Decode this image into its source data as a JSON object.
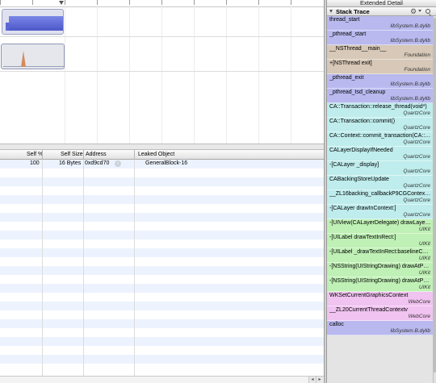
{
  "extended_detail_title": "Extended Detail",
  "stack_trace": {
    "title": "Stack Trace",
    "icons": [
      "triangle-disclosure-icon",
      "gear-icon",
      "search-icon"
    ],
    "frames": [
      {
        "function": "thread_start",
        "library": "libSystem.B.dylib",
        "color": "#b9b9ef"
      },
      {
        "function": "_pthread_start",
        "library": "libSystem.B.dylib",
        "color": "#b9b9ef"
      },
      {
        "function": "__NSThread__main__",
        "library": "Foundation",
        "color": "#d7c8b7"
      },
      {
        "function": "+[NSThread exit]",
        "library": "Foundation",
        "color": "#d7c8b7"
      },
      {
        "function": "_pthread_exit",
        "library": "libSystem.B.dylib",
        "color": "#b9b9ef"
      },
      {
        "function": "_pthread_tsd_cleanup",
        "library": "libSystem.B.dylib",
        "color": "#b9b9ef"
      },
      {
        "function": "CA::Transaction::release_thread(void*)",
        "library": "QuartzCore",
        "color": "#bfecec"
      },
      {
        "function": "CA::Transaction::commit()",
        "library": "QuartzCore",
        "color": "#bfecec"
      },
      {
        "function": "CA::Context::commit_transaction(CA::Tr...",
        "library": "QuartzCore",
        "color": "#bfecec"
      },
      {
        "function": "CALayerDisplayIfNeeded",
        "library": "QuartzCore",
        "color": "#bfecec"
      },
      {
        "function": "-[CALayer _display]",
        "library": "QuartzCore",
        "color": "#bfecec"
      },
      {
        "function": "CABackingStoreUpdate",
        "library": "QuartzCore",
        "color": "#bfecec"
      },
      {
        "function": "__ZL16backing_callbackP9CGContextPv",
        "library": "QuartzCore",
        "color": "#bfecec"
      },
      {
        "function": "-[CALayer drawInContext:]",
        "library": "QuartzCore",
        "color": "#bfecec"
      },
      {
        "function": "-[UIView(CALayerDelegate) drawLayer:in...",
        "library": "UIKit",
        "color": "#bff0b5"
      },
      {
        "function": "-[UILabel drawTextInRect:]",
        "library": "UIKit",
        "color": "#bff0b5"
      },
      {
        "function": "-[UILabel _drawTextInRect:baselineCalcu...",
        "library": "UIKit",
        "color": "#bff0b5"
      },
      {
        "function": "-[NSString(UIStringDrawing) drawAtPoint...",
        "library": "UIKit",
        "color": "#bff0b5"
      },
      {
        "function": "-[NSString(UIStringDrawing) drawAtPoint...",
        "library": "UIKit",
        "color": "#bff0b5"
      },
      {
        "function": "WKSetCurrentGraphicsContext",
        "library": "WebCore",
        "color": "#f0c3f0"
      },
      {
        "function": "__ZL20CurrentThreadContextv",
        "library": "WebCore",
        "color": "#f0c3f0"
      },
      {
        "function": "calloc",
        "library": "libSystem.B.dylib",
        "color": "#b9b9ef"
      }
    ]
  },
  "leaks_table": {
    "columns": [
      "Self %",
      "Self Size",
      "Address",
      "Leaked Object"
    ],
    "rows": [
      {
        "self_percent": "100",
        "self_size": "16 Bytes",
        "address": "0xd9cd70",
        "leaked_object": "GeneralBlock-16"
      }
    ]
  },
  "colors": {
    "row_alternate": "#edf3fe",
    "track_allocations": "#5a66d6",
    "track_leaks": "#d48a5c"
  }
}
